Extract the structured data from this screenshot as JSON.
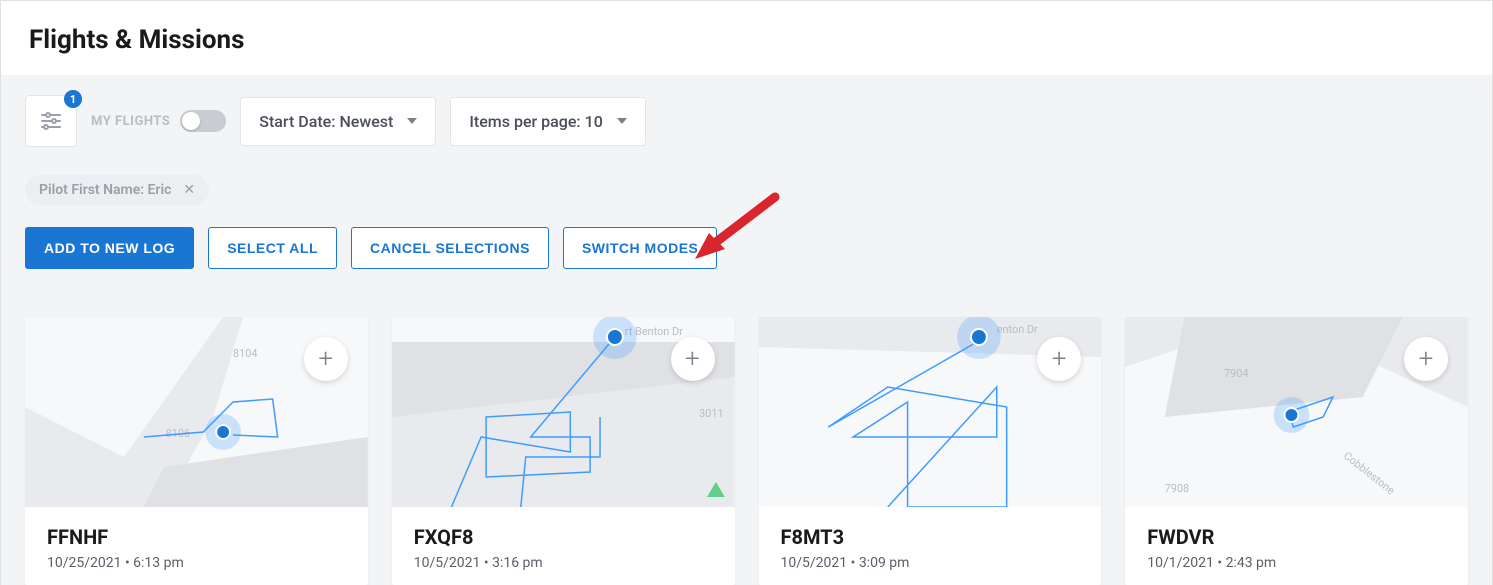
{
  "header": {
    "title": "Flights & Missions"
  },
  "filters": {
    "badge_count": "1",
    "my_flights_label": "MY FLIGHTS",
    "sort_label": "Start Date: Newest",
    "per_page_label": "Items per page: 10",
    "chip": {
      "label": "Pilot First Name: Eric"
    }
  },
  "actions": {
    "add_to_new_log": "ADD TO NEW LOG",
    "select_all": "SELECT ALL",
    "cancel_selections": "CANCEL SELECTIONS",
    "switch_modes": "SWITCH MODES"
  },
  "cards": [
    {
      "code": "FFNHF",
      "date": "10/25/2021",
      "time": "6:13 pm"
    },
    {
      "code": "FXQF8",
      "date": "10/5/2021",
      "time": "3:16 pm"
    },
    {
      "code": "F8MT3",
      "date": "10/5/2021",
      "time": "3:09 pm"
    },
    {
      "code": "FWDVR",
      "date": "10/1/2021",
      "time": "2:43 pm"
    }
  ],
  "map_labels": {
    "card0_a": "8104",
    "card0_b": "8106",
    "card1_street": "rt Benton Dr",
    "card1_num": "3011",
    "card2_street": "enton Dr",
    "card3_a": "7904",
    "card3_b": "7908",
    "card3_street": "Cobblestone"
  },
  "colors": {
    "accent": "#1976d2",
    "path": "#3f9cff",
    "map_bg": "#e9eaed",
    "map_road": "#f7f8fa",
    "map_block": "#dfe1e5"
  }
}
